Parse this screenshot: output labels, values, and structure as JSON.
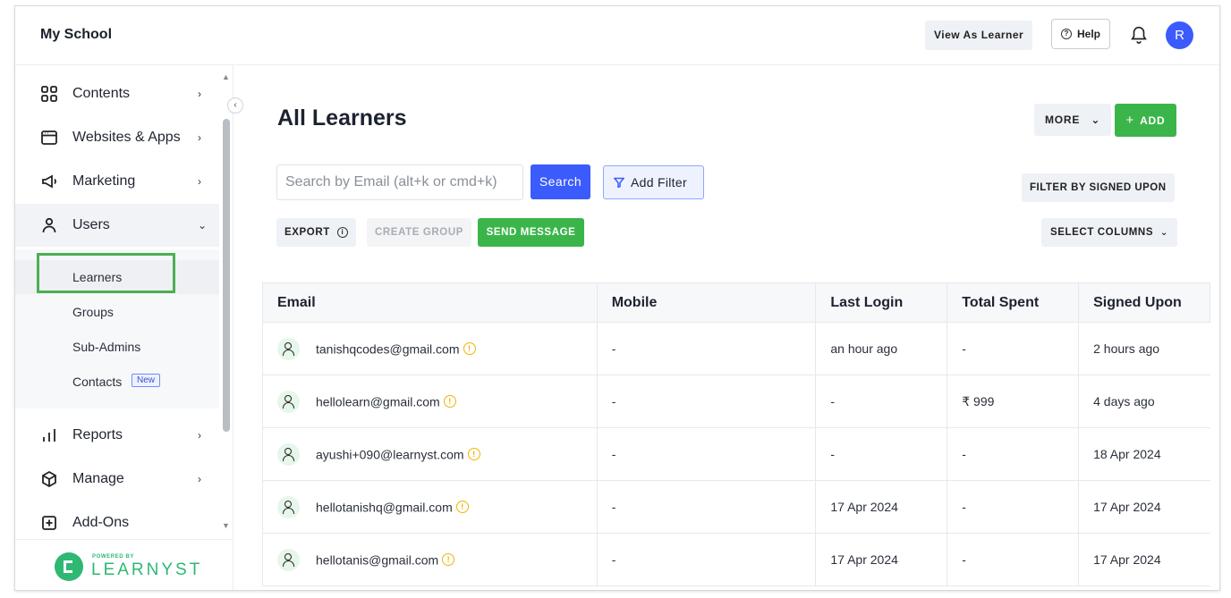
{
  "header": {
    "school_name": "My School",
    "view_as_learner": "View As Learner",
    "help": "Help",
    "user_initial": "R"
  },
  "sidebar": {
    "items": [
      {
        "label": "Contents",
        "icon": "grid-icon",
        "chevron": "›"
      },
      {
        "label": "Websites & Apps",
        "icon": "browser-window-icon",
        "chevron": "›"
      },
      {
        "label": "Marketing",
        "icon": "megaphone-icon",
        "chevron": "›"
      },
      {
        "label": "Users",
        "icon": "user-icon",
        "chevron": "⌄"
      },
      {
        "label": "Reports",
        "icon": "bar-chart-icon",
        "chevron": "›"
      },
      {
        "label": "Manage",
        "icon": "cube-icon",
        "chevron": "›"
      },
      {
        "label": "Add-Ons",
        "icon": "plus-square-icon",
        "chevron": ""
      }
    ],
    "users_submenu": [
      {
        "label": "Learners"
      },
      {
        "label": "Groups"
      },
      {
        "label": "Sub-Admins"
      },
      {
        "label": "Contacts",
        "badge": "New"
      }
    ],
    "brand": {
      "powered_by": "POWERED BY",
      "name": "LEARNYST",
      "color": "#2eb872"
    }
  },
  "main": {
    "title": "All Learners",
    "more": "MORE",
    "add": "ADD",
    "search_placeholder": "Search by Email (alt+k or cmd+k)",
    "search_button": "Search",
    "add_filter": "Add Filter",
    "filter_by_signed_upon": "FILTER BY SIGNED UPON",
    "export": "EXPORT",
    "create_group": "CREATE GROUP",
    "send_message": "SEND MESSAGE",
    "select_columns": "SELECT COLUMNS"
  },
  "table": {
    "columns": [
      "Email",
      "Mobile",
      "Last Login",
      "Total Spent",
      "Signed Upon"
    ],
    "rows": [
      {
        "email": "tanishqcodes@gmail.com",
        "mobile": "-",
        "last_login": "an hour ago",
        "total_spent": "-",
        "signed_upon": "2 hours ago"
      },
      {
        "email": "hellolearn@gmail.com",
        "mobile": "-",
        "last_login": "-",
        "total_spent": "₹ 999",
        "signed_upon": "4 days ago"
      },
      {
        "email": "ayushi+090@learnyst.com",
        "mobile": "-",
        "last_login": "-",
        "total_spent": "-",
        "signed_upon": "18 Apr 2024"
      },
      {
        "email": "hellotanishq@gmail.com",
        "mobile": "-",
        "last_login": "17 Apr 2024",
        "total_spent": "-",
        "signed_upon": "17 Apr 2024"
      },
      {
        "email": "hellotanis@gmail.com",
        "mobile": "-",
        "last_login": "17 Apr 2024",
        "total_spent": "-",
        "signed_upon": "17 Apr 2024"
      }
    ]
  },
  "colors": {
    "primary": "#3b5bfd",
    "success": "#3bb54a",
    "warning": "#f0b400",
    "highlight_box": "#4caf50"
  }
}
